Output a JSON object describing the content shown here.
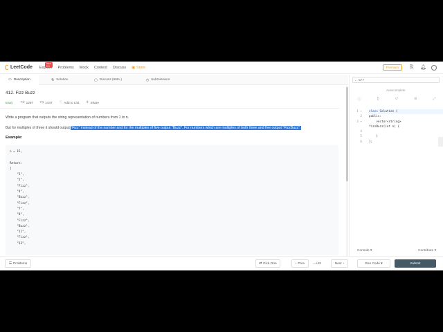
{
  "nav": {
    "brand": "LeetCode",
    "links": [
      "Explore",
      "Problems",
      "Mock",
      "Contest",
      "Discuss"
    ],
    "new_badge": "New 2.0",
    "store": "Store",
    "premium": "Premium"
  },
  "tabs": [
    {
      "icon": "▭",
      "label": "Description"
    },
    {
      "icon": "⚗",
      "label": "Solution"
    },
    {
      "icon": "▢",
      "label": "Discuss (999+)"
    },
    {
      "icon": "◷",
      "label": "Submissions"
    }
  ],
  "problem": {
    "title": "412. Fizz Buzz",
    "difficulty": "Easy",
    "likes": "1297",
    "dislikes": "1437",
    "add_to_list": "Add to List",
    "share": "Share",
    "para1": "Write a program that outputs the string representation of numbers from 1 to n.",
    "para2_pre": "But for multiples of three it should output ",
    "para2_hl": "\"Fizz\" instead of the number and for the multiples of five output \"Buzz\". For numbers which are multiples of both three and five output \"FizzBuzz\".",
    "example_heading": "Example:",
    "example_code": "n = 15,\n\nReturn:\n[\n    \"1\",\n    \"2\",\n    \"Fizz\",\n    \"4\",\n    \"Buzz\",\n    \"Fizz\",\n    \"7\",\n    \"8\",\n    \"Fizz\",\n    \"Buzz\",\n    \"11\",\n    \"Fizz\",\n    \"13\","
  },
  "editor": {
    "language": "C++",
    "autocomplete": "Autocomplete",
    "line_numbers": "1 ▾\n2\n3 ▾\n\n4\n5\n6",
    "line1_kw": "class",
    "line1_rest": " Solution {",
    "code_rest": "public:\n    vector<string>\nfizzBuzz(int n) {\n\n    }\n};",
    "console": "Console ▾",
    "contribute": "Contribute ▾"
  },
  "bottom": {
    "problems": "Problems",
    "pick_one": "Pick One",
    "prev": "Prev",
    "page": "/43",
    "next": "Next",
    "run_code": "Run Code ▾",
    "submit": "Submit"
  }
}
